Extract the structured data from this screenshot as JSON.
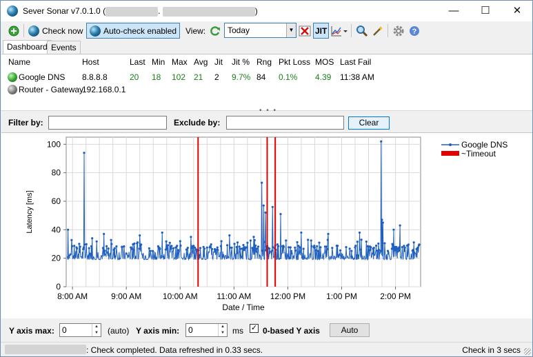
{
  "window": {
    "title": "Sever Sonar v7.0.1.0 (",
    "title_sep": ".",
    "title_end": ")",
    "minimize": "—",
    "maximize": "☐",
    "close": "✕"
  },
  "toolbar": {
    "check_now": "Check now",
    "auto_check": "Auto-check enabled",
    "view_label": "View:",
    "view_value": "Today",
    "jit": "JIT"
  },
  "tabs": [
    {
      "label": "Dashboard"
    },
    {
      "label": "Events"
    }
  ],
  "table": {
    "columns": [
      "Name",
      "Host",
      "Last",
      "Min",
      "Max",
      "Avg",
      "Jit",
      "Jit %",
      "Rng",
      "Pkt Loss",
      "MOS",
      "Last Fail"
    ],
    "rows": [
      {
        "status_color": "#33a02c",
        "name": "Google DNS",
        "host": "8.8.8.8",
        "last": "20",
        "min": "18",
        "max": "102",
        "avg": "21",
        "jit": "2",
        "jit_pct": "9.7%",
        "rng": "84",
        "pkt_loss": "0.1%",
        "mos": "4.39",
        "last_fail": "11:38 AM"
      },
      {
        "status_color": "#6a6a6a",
        "name": "Router - Gateway",
        "host": "192.168.0.1",
        "last": "",
        "min": "",
        "max": "",
        "avg": "",
        "jit": "",
        "jit_pct": "",
        "rng": "",
        "pkt_loss": "",
        "mos": "",
        "last_fail": ""
      }
    ]
  },
  "splitter_mark": "• • •",
  "filter": {
    "filter_label": "Filter by:",
    "filter_value": "",
    "exclude_label": "Exclude by:",
    "exclude_value": "",
    "clear_label": "Clear"
  },
  "chart_data": {
    "type": "line",
    "title": "",
    "xlabel": "Date / Time",
    "ylabel": "Latency [ms]",
    "ylim": [
      0,
      105
    ],
    "yticks": [
      0,
      20,
      40,
      60,
      80,
      100
    ],
    "xticks": [
      "8:00 AM",
      "9:00 AM",
      "10:00 AM",
      "11:00 AM",
      "12:00 PM",
      "1:00 PM",
      "2:00 PM"
    ],
    "xlim": [
      "07:53",
      "14:28"
    ],
    "grid": true,
    "legend_position": "top-right",
    "series": [
      {
        "name": "Google DNS",
        "color": "#1f5fbf",
        "baseline_range_ms": [
          18,
          30
        ],
        "spikes": [
          {
            "time": "07:55",
            "value": 40
          },
          {
            "time": "08:13",
            "value": 94
          },
          {
            "time": "08:22",
            "value": 34
          },
          {
            "time": "08:35",
            "value": 37
          },
          {
            "time": "09:15",
            "value": 36
          },
          {
            "time": "09:40",
            "value": 38
          },
          {
            "time": "10:12",
            "value": 35
          },
          {
            "time": "10:55",
            "value": 36
          },
          {
            "time": "11:22",
            "value": 35
          },
          {
            "time": "11:31",
            "value": 73
          },
          {
            "time": "11:33",
            "value": 57
          },
          {
            "time": "11:35",
            "value": 52
          },
          {
            "time": "11:43",
            "value": 56
          },
          {
            "time": "11:52",
            "value": 51
          },
          {
            "time": "12:15",
            "value": 38
          },
          {
            "time": "12:45",
            "value": 37
          },
          {
            "time": "13:20",
            "value": 38
          },
          {
            "time": "13:44",
            "value": 102
          },
          {
            "time": "13:45",
            "value": 47
          },
          {
            "time": "13:46",
            "value": 45
          },
          {
            "time": "13:58",
            "value": 40
          },
          {
            "time": "14:05",
            "value": 43
          }
        ]
      },
      {
        "name": "~Timeout",
        "color": "#e00000",
        "times": [
          "10:20",
          "11:37",
          "11:46"
        ]
      }
    ]
  },
  "bottom": {
    "ymax_label": "Y axis max:",
    "ymax_value": "0",
    "ymax_hint": "(auto)",
    "ymin_label": "Y axis min:",
    "ymin_value": "0",
    "ymin_unit": "ms",
    "zero_based_label": "0-based Y axis",
    "zero_based_checked": "✓",
    "auto_label": "Auto"
  },
  "status": {
    "message": ": Check completed. Data refreshed in 0.33 secs.",
    "right": "Check in 3 secs"
  }
}
